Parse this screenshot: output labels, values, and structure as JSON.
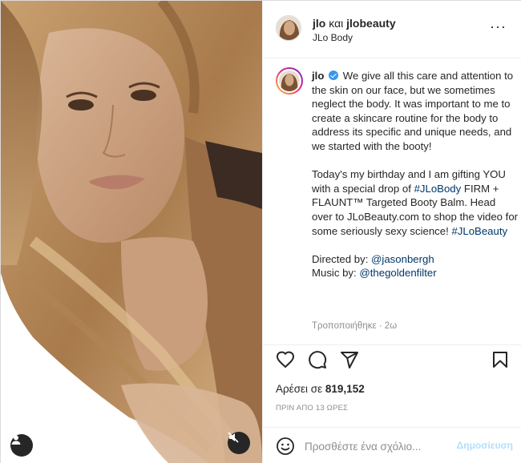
{
  "header": {
    "username": "jlo",
    "joiner": " και ",
    "collaborator": "jlobeauty",
    "subtitle": "JLo Body",
    "more_icon": "more-horizontal-icon",
    "more_glyph": "···"
  },
  "caption": {
    "username": "jlo",
    "paragraph1": "We give all this care and attention to the skin on our face, but we sometimes neglect the body. It was important to me to create a skincare routine for the body to address its specific and unique needs, and we started with the booty!",
    "p2_part1": "Today's my birthday and I am gifting YOU with a special drop of ",
    "p2_tag1": "#JLoBody",
    "p2_part2": " FIRM + FLAUNT™ Targeted Booty Balm. Head over to JLoBeauty.com to shop the video for some seriously sexy science! ",
    "p2_tag2": "#JLoBeauty",
    "directed_label": "Directed by: ",
    "directed_handle": "@jasonbergh",
    "music_label": "Music by: ",
    "music_handle": "@thegoldenfilter",
    "edited": "Τροποποιήθηκε · 2ω"
  },
  "actions": {
    "likes_label": "Αρέσει σε ",
    "likes_count": "819,152",
    "timestamp": "ΠΡΙΝ ΑΠΟ 13 ΩΡΕΣ"
  },
  "comment": {
    "placeholder": "Προσθέστε ένα σχόλιο...",
    "post_label": "Δημοσίευση"
  },
  "colors": {
    "link": "#00376b",
    "verified": "#3897f0",
    "post_disabled": "#b2dffc",
    "muted_text": "#8e8e8e"
  }
}
